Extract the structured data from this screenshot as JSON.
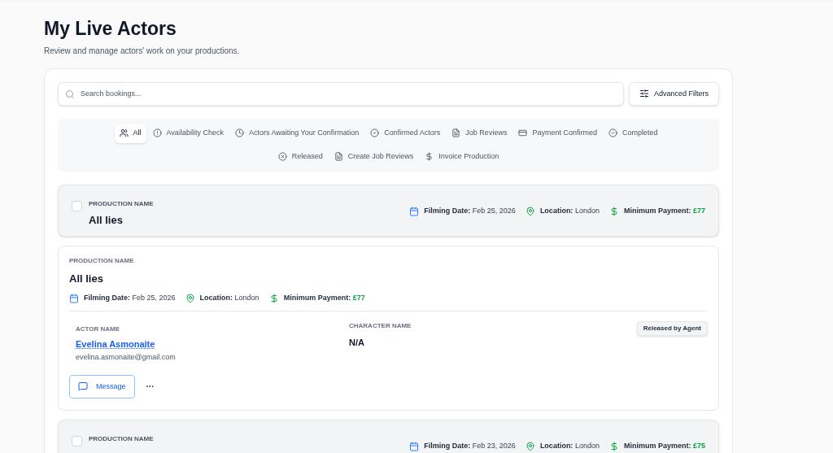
{
  "page": {
    "title": "My Live Actors",
    "subtitle": "Review and manage actors' work on your productions."
  },
  "search": {
    "placeholder": "Search bookings..."
  },
  "advanced_filters": "Advanced Filters",
  "filters": [
    {
      "label": "All",
      "selected": true
    },
    {
      "label": "Availability Check",
      "selected": false
    },
    {
      "label": "Actors Awaiting Your Confirmation",
      "selected": false
    },
    {
      "label": "Confirmed Actors",
      "selected": false
    },
    {
      "label": "Job Reviews",
      "selected": false
    },
    {
      "label": "Payment Confirmed",
      "selected": false
    },
    {
      "label": "Completed",
      "selected": false
    },
    {
      "label": "Released",
      "selected": false
    },
    {
      "label": "Create Job Reviews",
      "selected": false
    },
    {
      "label": "Invoice Production",
      "selected": false
    }
  ],
  "cards": [
    {
      "kind": "group",
      "checked": false,
      "label": "PRODUCTION NAME",
      "name": "All lies",
      "meta": [
        {
          "label": "Filming Date:",
          "value": "Feb 25, 2026"
        },
        {
          "label": "Location:",
          "value": "London"
        },
        {
          "label": "Minimum Payment:",
          "value": "£77"
        }
      ]
    },
    {
      "kind": "detail",
      "label": "PRODUCTION NAME",
      "name": "All lies",
      "meta": [
        {
          "label": "Filming Date:",
          "value": "Feb 25, 2026"
        },
        {
          "label": "Location:",
          "value": "London"
        },
        {
          "label": "Minimum Payment:",
          "value": "£77"
        }
      ],
      "actor": {
        "label": "ACTOR NAME",
        "name": "Evelina Asmonaite",
        "email": "evelina.asmonaite@gmail.com"
      },
      "character": {
        "label": "CHARACTER NAME",
        "name": "N/A"
      },
      "status": "Released by Agent",
      "message": "Message",
      "more": "···"
    },
    {
      "kind": "group",
      "checked": false,
      "label": "PRODUCTION NAME",
      "meta": [
        {
          "label": "Filming Date:",
          "value": "Feb 23, 2026"
        },
        {
          "label": "Location:",
          "value": "London"
        },
        {
          "label": "Minimum Payment:",
          "value": "£75"
        }
      ]
    }
  ]
}
